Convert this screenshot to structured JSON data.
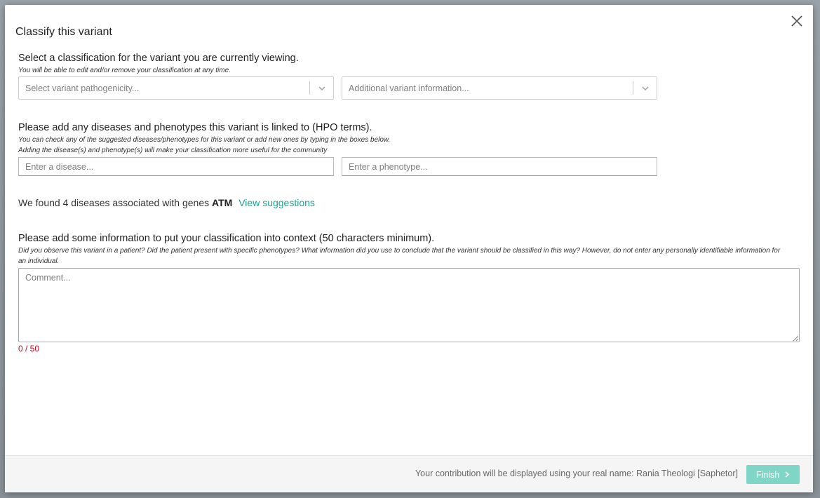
{
  "dialog": {
    "title": "Classify this variant"
  },
  "classification": {
    "heading": "Select a classification for the variant you are currently viewing.",
    "hint": "You will be able to edit and/or remove your classification at any time.",
    "pathogenicity_placeholder": "Select variant pathogenicity...",
    "additional_placeholder": "Additional variant information..."
  },
  "phenotypes": {
    "heading": "Please add any diseases and phenotypes this variant is linked to (HPO terms).",
    "hint_line1": "You can check any of the suggested diseases/phenotypes for this variant or add new ones by typing in the boxes below.",
    "hint_line2": "Adding the disease(s) and phenotype(s) will make your classification more useful for the community",
    "disease_placeholder": "Enter a disease...",
    "phenotype_placeholder": "Enter a phenotype..."
  },
  "suggestions": {
    "text": "We found 4 diseases associated with genes",
    "gene": "ATM",
    "link": "View suggestions"
  },
  "context": {
    "heading": "Please add some information to put your classification into context (50 characters minimum).",
    "hint": "Did you observe this variant in a patient? Did the patient present with specific phenotypes? What information did you use to conclude that the variant should be classified in this way? However, do not enter any personally identifiable information for an individual.",
    "comment_placeholder": "Comment...",
    "counter": "0 / 50"
  },
  "footer": {
    "attribution": "Your contribution will be displayed using your real name: Rania Theologi [Saphetor]",
    "finish_label": "Finish"
  },
  "colors": {
    "accent": "#1aa58f",
    "finish_button": "#7fd6c7",
    "counter_error": "#d0021b"
  }
}
